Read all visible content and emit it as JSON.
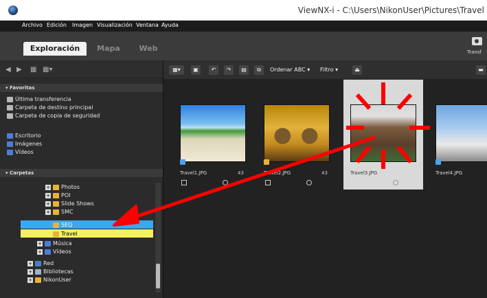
{
  "window": {
    "title": "ViewNX-i - C:\\Users\\NikonUser\\Pictures\\Travel"
  },
  "menu": [
    "Archivo",
    "Edición",
    "Imagen",
    "Visualización",
    "Ventana",
    "Ayuda"
  ],
  "tabs": {
    "active": "Exploración",
    "items": [
      "Exploración",
      "Mapa",
      "Web"
    ]
  },
  "transfer": {
    "label": "Transf"
  },
  "left_panel": {
    "nav": [
      "◀",
      "▶",
      "▦",
      "▦▾"
    ],
    "favorites": {
      "header": "Favoritas",
      "items": [
        "Última transferencia",
        "Carpeta de destino principal",
        "Carpeta de copia de seguridad",
        "Escritorio",
        "Imágenes",
        "Vídeos"
      ]
    },
    "folders": {
      "header": "Carpetas",
      "items": [
        "Photos",
        "POI",
        "Slide Shows",
        "SMC",
        "SEQ",
        "Travel",
        "Música",
        "Vídeos",
        "Red",
        "Bibliotecas",
        "NikonUser"
      ]
    }
  },
  "main_toolbar": {
    "sort_label": "Ordenar ABC ▾",
    "filter_label": "Filtro ▾",
    "buttons": [
      "▦▾",
      "▣",
      "↶",
      "↷",
      "▤",
      "⧉",
      "⏏",
      "▬"
    ]
  },
  "thumbnails": [
    {
      "filename": "Travel1.JPG",
      "num": "43"
    },
    {
      "filename": "Travel2.JPG",
      "num": "43"
    },
    {
      "filename": "Travel3.JPG",
      "num": ""
    },
    {
      "filename": "Travel4.JPG",
      "num": ""
    }
  ],
  "colors": {
    "accent_select": "#3aa8f2",
    "highlight": "#f5f060",
    "arrow": "#ff0000"
  }
}
